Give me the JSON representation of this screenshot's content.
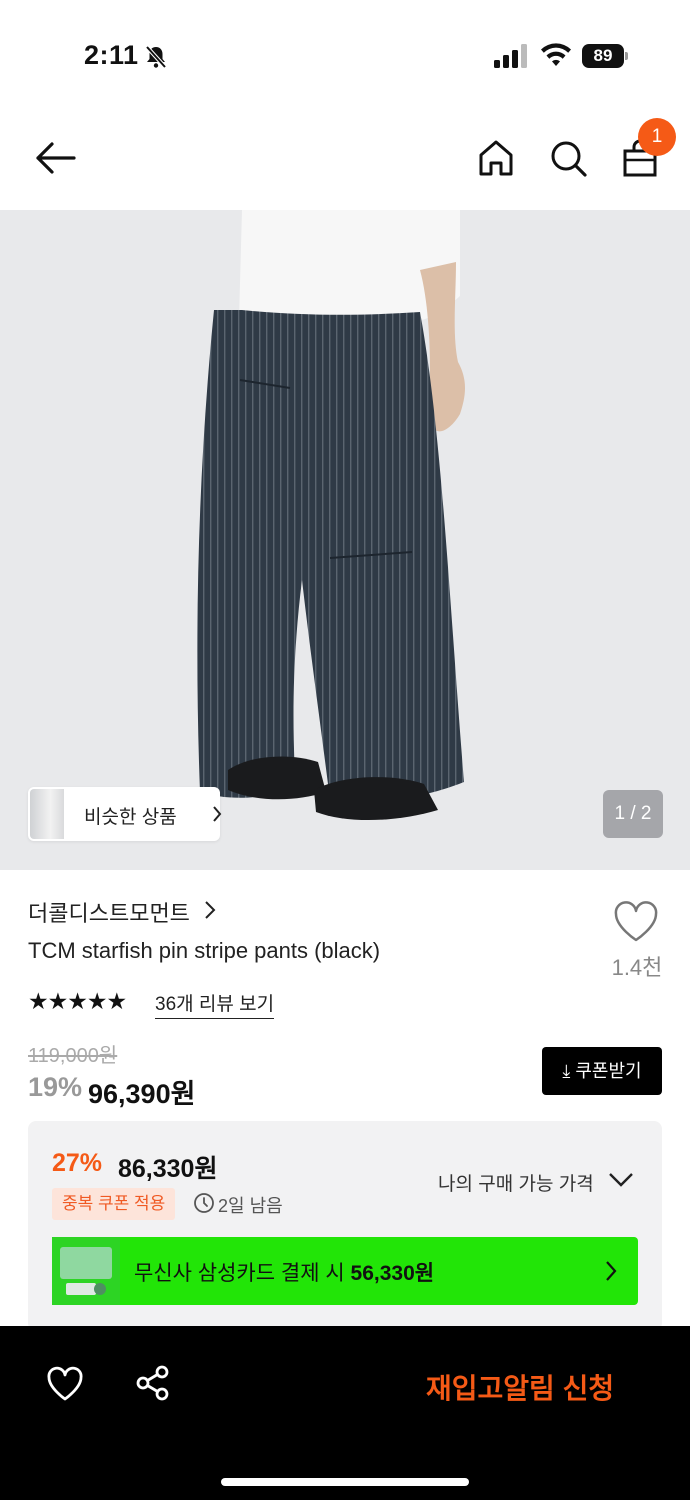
{
  "status_bar": {
    "time": "2:11",
    "battery": "89"
  },
  "nav": {
    "cart_count": "1"
  },
  "gallery": {
    "similar_label": "비슷한 상품",
    "pager": "1 / 2"
  },
  "product": {
    "brand": "더콜디스트모먼트",
    "name": "TCM starfish pin stripe pants (black)",
    "like_count": "1.4천",
    "rating_stars": "★★★★★",
    "reviews_link": "36개 리뷰 보기",
    "original_price": "119,000원",
    "discount_rate": "19%",
    "sale_price": "96,390원",
    "coupon_button": "⤓ 쿠폰받기"
  },
  "benefit": {
    "rate": "27%",
    "price": "86,330원",
    "dup_coupon": "중복 쿠폰 적용",
    "remaining": "2일 남음",
    "my_price_label": "나의 구매 가능 가격",
    "card_text": "무신사 삼성카드 결제 시 ",
    "card_price": "56,330원"
  },
  "bottom_bar": {
    "restock_label": "재입고알림 신청"
  },
  "colors": {
    "accent": "#f55a16",
    "card_green": "#22e507"
  }
}
